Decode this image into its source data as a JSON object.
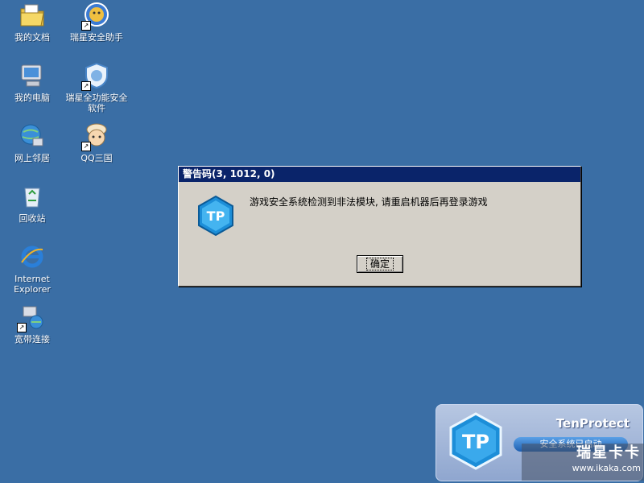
{
  "desktop": {
    "icons": [
      {
        "label": "我的文档",
        "icon": "my-documents-icon"
      },
      {
        "label": "瑞星安全助手",
        "icon": "rising-assistant-icon",
        "shortcut": true
      },
      {
        "label": "我的电脑",
        "icon": "my-computer-icon"
      },
      {
        "label": "瑞星全功能安全软件",
        "icon": "rising-security-icon",
        "shortcut": true
      },
      {
        "label": "网上邻居",
        "icon": "network-places-icon"
      },
      {
        "label": "QQ三国",
        "icon": "qq-sanguo-icon",
        "shortcut": true
      },
      {
        "label": "回收站",
        "icon": "recycle-bin-icon"
      },
      {
        "label": "Internet Explorer",
        "icon": "internet-explorer-icon"
      },
      {
        "label": "宽带连接",
        "icon": "broadband-connection-icon",
        "shortcut": true
      }
    ]
  },
  "dialog": {
    "title": "警告码(3, 1012, 0)",
    "message": "游戏安全系统检测到非法模块, 请重启机器后再登录游戏",
    "ok_label": "确定",
    "icon": "tenprotect-icon"
  },
  "tenprotect": {
    "title": "TenProtect",
    "status": "安全系统已启动"
  },
  "watermark": {
    "text": "瑞星卡卡",
    "url": "www.ikaka.com"
  },
  "colors": {
    "desktop_bg": "#3a6ea5",
    "titlebar": "#0a246a",
    "dialog_bg": "#d4d0c8"
  }
}
